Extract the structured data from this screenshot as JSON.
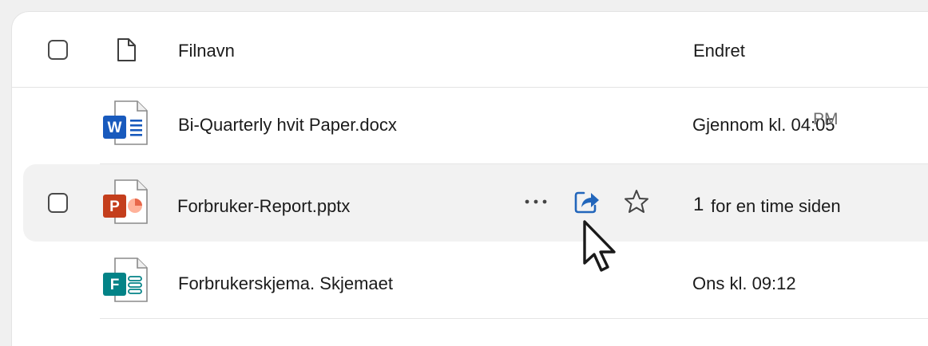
{
  "header": {
    "name_label": "Filnavn",
    "modified_label": "Endret"
  },
  "files": [
    {
      "name": "Bi-Quarterly hvit Paper.docx",
      "modified": "Gjennom kl. 04:05",
      "modified_overlap": "PM",
      "type": "word",
      "badge": "W"
    },
    {
      "name": "Forbruker-Report.pptx",
      "modified_num": "1",
      "modified": "for en time siden",
      "type": "powerpoint",
      "badge": "P"
    },
    {
      "name": "Forbrukerskjema. Skjemaet",
      "modified": "Ons kl. 09:12",
      "type": "forms",
      "badge": "F"
    }
  ],
  "colors": {
    "word": "#185abd",
    "powerpoint": "#c43e1c",
    "powerpoint_light": "#ff8f6b",
    "forms": "#038387",
    "share": "#2266bb"
  }
}
